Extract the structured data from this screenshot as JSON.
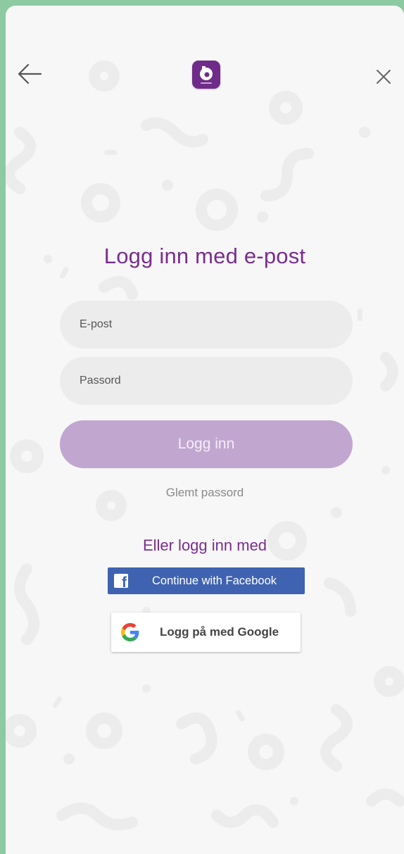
{
  "header": {
    "back_icon": "arrow-left-icon",
    "close_icon": "close-icon",
    "logo_letter": "b"
  },
  "title": "Logg inn med e-post",
  "form": {
    "email_placeholder": "E-post",
    "password_placeholder": "Passord",
    "login_label": "Logg inn",
    "forgot_label": "Glemt passord"
  },
  "alternatives": {
    "heading": "Eller logg inn med",
    "facebook_label": "Continue with Facebook",
    "google_label": "Logg på med Google"
  },
  "colors": {
    "frame": "#8dcaa2",
    "brand": "#7a2d8e",
    "login_button": "#c1a7d0",
    "facebook": "#3f63b1"
  }
}
